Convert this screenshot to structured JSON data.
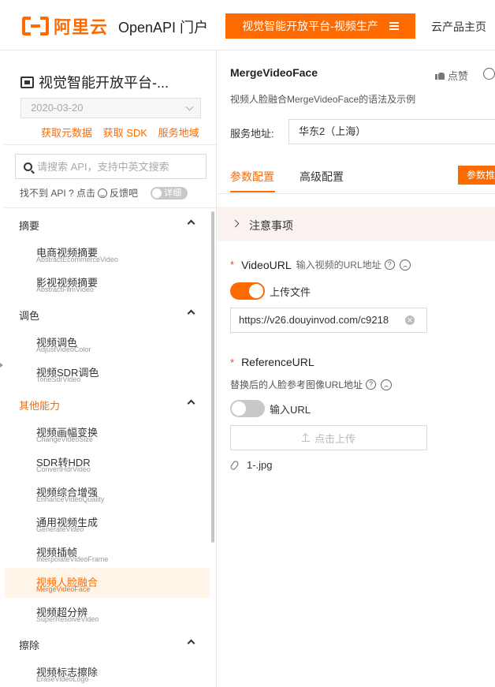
{
  "header": {
    "logo_text": "阿里云",
    "portal_title": "OpenAPI 门户",
    "product_button": "视觉智能开放平台-视频生产",
    "home_link": "云产品主页"
  },
  "sidebar": {
    "title": "视觉智能开放平台-...",
    "date": "2020-03-20",
    "links": [
      "获取元数据",
      "获取 SDK",
      "服务地域"
    ],
    "search_placeholder": "请搜索 API，支持中英文搜索",
    "feedback_prefix": "找不到 API ? 点击",
    "feedback_suffix": "反馈吧",
    "detail_toggle": "详细",
    "groups": [
      {
        "label": "摘要",
        "highlight": false,
        "items": [
          {
            "cn": "电商视频摘要",
            "en": "AbstractEcommerceVideo"
          },
          {
            "cn": "影视视频摘要",
            "en": "AbstractFilmVideo"
          }
        ]
      },
      {
        "label": "调色",
        "highlight": false,
        "items": [
          {
            "cn": "视频调色",
            "en": "AdjustVideoColor"
          },
          {
            "cn": "视频SDR调色",
            "en": "ToneSdrVideo"
          }
        ]
      },
      {
        "label": "其他能力",
        "highlight": true,
        "items": [
          {
            "cn": "视频画幅变换",
            "en": "ChangeVideoSize"
          },
          {
            "cn": "SDR转HDR",
            "en": "ConvertHdrVideo"
          },
          {
            "cn": "视频综合增强",
            "en": "EnhanceVideoQuality"
          },
          {
            "cn": "通用视频生成",
            "en": "GenerateVideo"
          },
          {
            "cn": "视频插帧",
            "en": "InterpolateVideoFrame"
          },
          {
            "cn": "视频人脸融合",
            "en": "MergeVideoFace",
            "active": true
          },
          {
            "cn": "视频超分辨",
            "en": "SuperResolveVideo"
          }
        ]
      },
      {
        "label": "擦除",
        "highlight": false,
        "items": [
          {
            "cn": "视频标志擦除",
            "en": "EraseVideoLogo"
          }
        ]
      }
    ]
  },
  "main": {
    "api_name": "MergeVideoFace",
    "like_label": "点赞",
    "description": "视频人脸融合MergeVideoFace的语法及示例",
    "region_label": "服务地址:",
    "region_value": "华东2（上海）",
    "tabs": [
      "参数配置",
      "高级配置"
    ],
    "tab_action": "参数推",
    "notice": "注意事项",
    "video_url": {
      "label": "VideoURL",
      "hint": "输入视频的URL地址",
      "toggle_label": "上传文件",
      "value": "https://v26.douyinvod.com/c9218"
    },
    "reference_url": {
      "label": "ReferenceURL",
      "hint": "替换后的人脸参考图像URL地址",
      "toggle_label": "输入URL",
      "upload_label": "点击上传",
      "file_name": "1-.jpg"
    }
  }
}
